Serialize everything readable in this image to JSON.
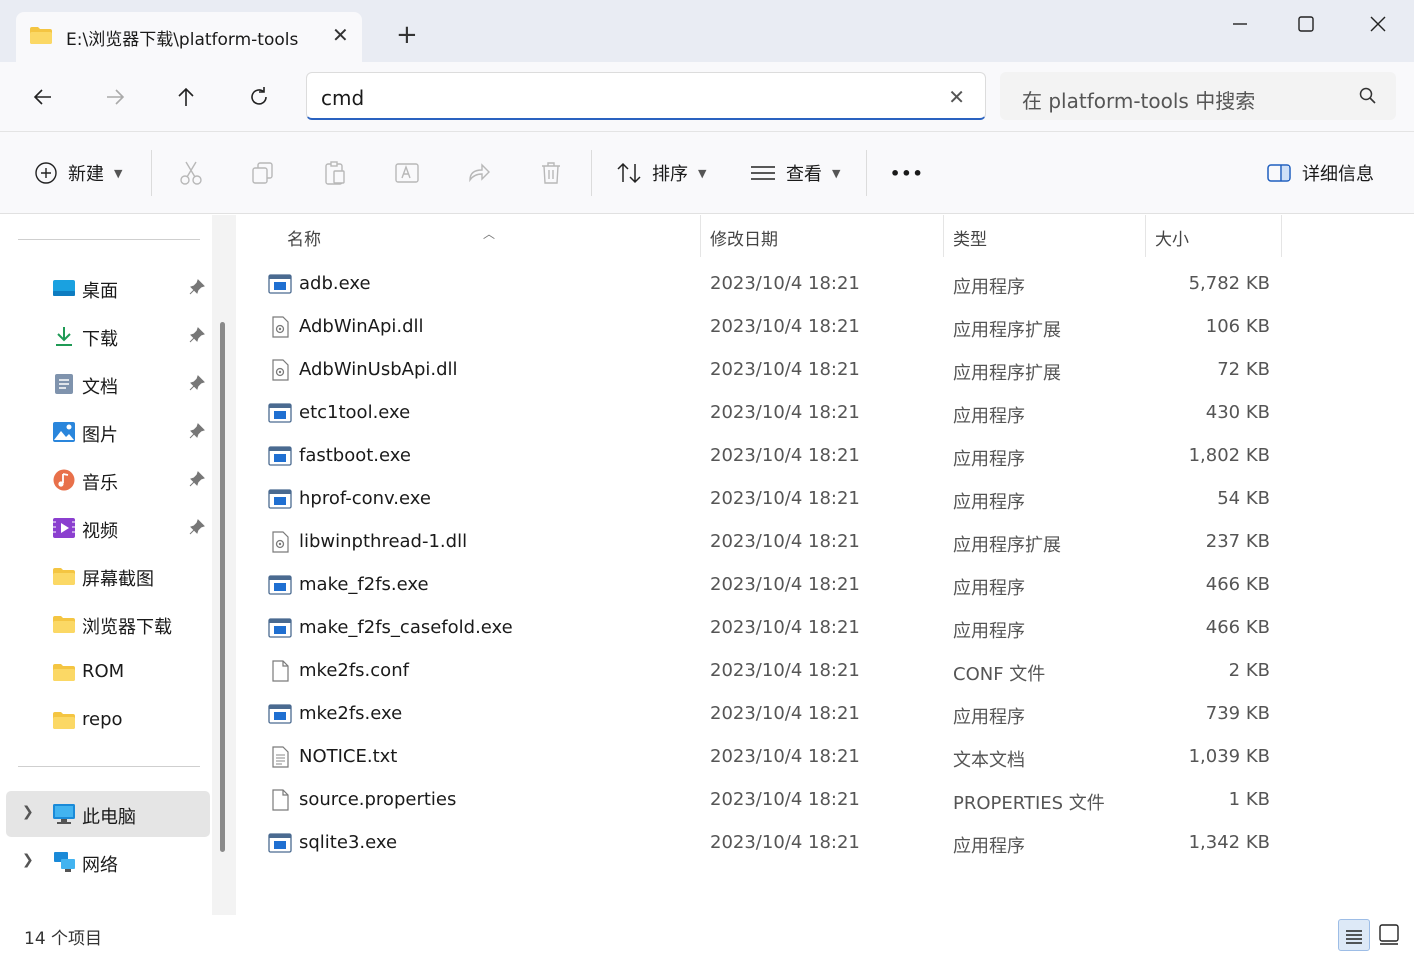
{
  "window": {
    "tab_title": "E:\\浏览器下载\\platform-tools",
    "tab_close_glyph": "✕",
    "new_tab_glyph": "+"
  },
  "navigation": {
    "address_value": "cmd",
    "address_clear_glyph": "✕",
    "search_placeholder": "在 platform-tools 中搜索"
  },
  "toolbar": {
    "new_label": "新建",
    "sort_label": "排序",
    "view_label": "查看",
    "more_label": "•••",
    "details_label": "详细信息"
  },
  "sidebar": {
    "quick_access": [
      {
        "label": "桌面",
        "icon": "desktop-icon",
        "pinned": true
      },
      {
        "label": "下载",
        "icon": "download-icon",
        "pinned": true
      },
      {
        "label": "文档",
        "icon": "document-icon",
        "pinned": true
      },
      {
        "label": "图片",
        "icon": "picture-icon",
        "pinned": true
      },
      {
        "label": "音乐",
        "icon": "music-icon",
        "pinned": true
      },
      {
        "label": "视频",
        "icon": "video-icon",
        "pinned": true
      },
      {
        "label": "屏幕截图",
        "icon": "folder-icon",
        "pinned": false
      },
      {
        "label": "浏览器下载",
        "icon": "folder-icon",
        "pinned": false
      },
      {
        "label": "ROM",
        "icon": "folder-icon",
        "pinned": false
      },
      {
        "label": "repo",
        "icon": "folder-icon",
        "pinned": false
      }
    ],
    "this_pc": "此电脑",
    "network": "网络"
  },
  "columns": {
    "name": "名称",
    "date": "修改日期",
    "type": "类型",
    "size": "大小"
  },
  "files": [
    {
      "name": "adb.exe",
      "date": "2023/10/4 18:21",
      "type": "应用程序",
      "size": "5,782 KB",
      "kind": "exe"
    },
    {
      "name": "AdbWinApi.dll",
      "date": "2023/10/4 18:21",
      "type": "应用程序扩展",
      "size": "106 KB",
      "kind": "dll"
    },
    {
      "name": "AdbWinUsbApi.dll",
      "date": "2023/10/4 18:21",
      "type": "应用程序扩展",
      "size": "72 KB",
      "kind": "dll"
    },
    {
      "name": "etc1tool.exe",
      "date": "2023/10/4 18:21",
      "type": "应用程序",
      "size": "430 KB",
      "kind": "exe"
    },
    {
      "name": "fastboot.exe",
      "date": "2023/10/4 18:21",
      "type": "应用程序",
      "size": "1,802 KB",
      "kind": "exe"
    },
    {
      "name": "hprof-conv.exe",
      "date": "2023/10/4 18:21",
      "type": "应用程序",
      "size": "54 KB",
      "kind": "exe"
    },
    {
      "name": "libwinpthread-1.dll",
      "date": "2023/10/4 18:21",
      "type": "应用程序扩展",
      "size": "237 KB",
      "kind": "dll"
    },
    {
      "name": "make_f2fs.exe",
      "date": "2023/10/4 18:21",
      "type": "应用程序",
      "size": "466 KB",
      "kind": "exe"
    },
    {
      "name": "make_f2fs_casefold.exe",
      "date": "2023/10/4 18:21",
      "type": "应用程序",
      "size": "466 KB",
      "kind": "exe"
    },
    {
      "name": "mke2fs.conf",
      "date": "2023/10/4 18:21",
      "type": "CONF 文件",
      "size": "2 KB",
      "kind": "file"
    },
    {
      "name": "mke2fs.exe",
      "date": "2023/10/4 18:21",
      "type": "应用程序",
      "size": "739 KB",
      "kind": "exe"
    },
    {
      "name": "NOTICE.txt",
      "date": "2023/10/4 18:21",
      "type": "文本文档",
      "size": "1,039 KB",
      "kind": "txt"
    },
    {
      "name": "source.properties",
      "date": "2023/10/4 18:21",
      "type": "PROPERTIES 文件",
      "size": "1 KB",
      "kind": "file"
    },
    {
      "name": "sqlite3.exe",
      "date": "2023/10/4 18:21",
      "type": "应用程序",
      "size": "1,342 KB",
      "kind": "exe"
    }
  ],
  "status": {
    "item_count": "14 个项目"
  },
  "colors": {
    "accent": "#2a62c0",
    "folder": "#f4c542",
    "exe_blue": "#1f6fd1"
  }
}
